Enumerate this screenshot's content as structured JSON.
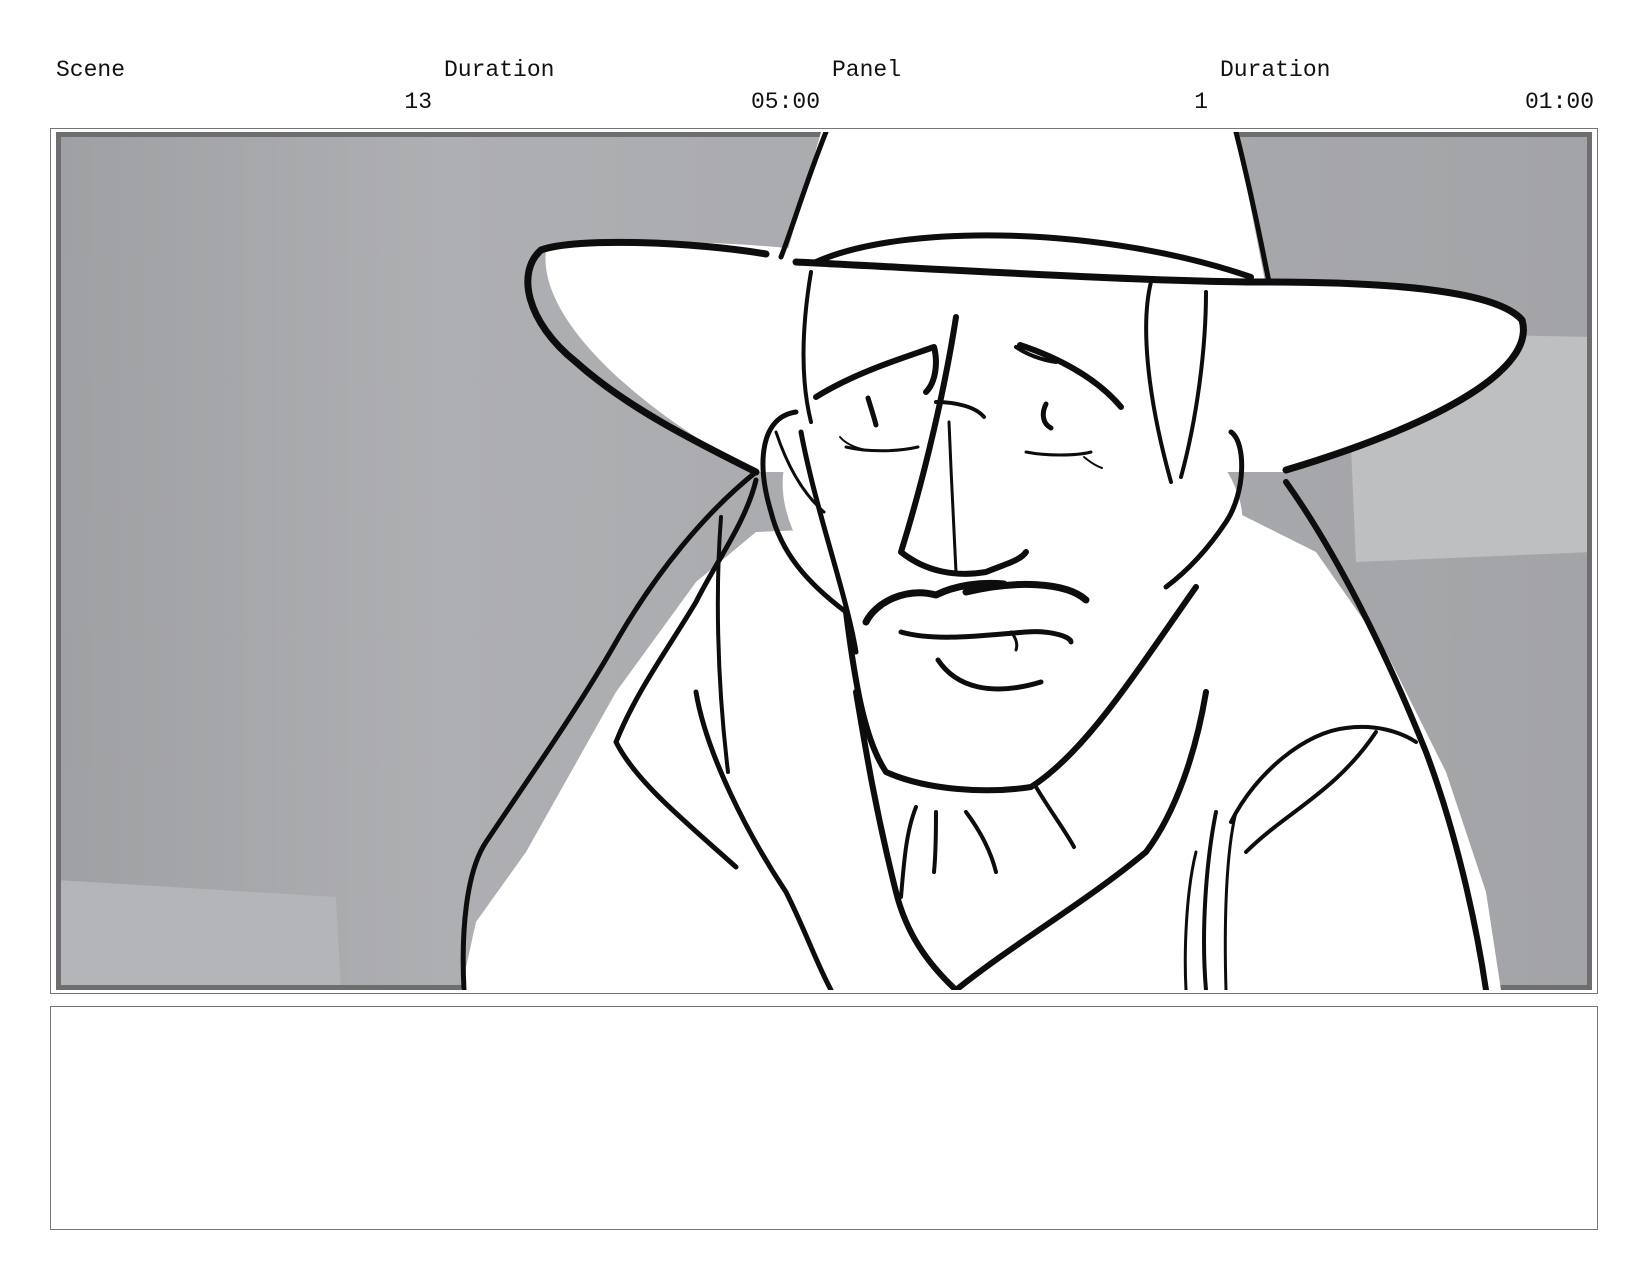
{
  "header": {
    "scene_label": "Scene",
    "scene_duration_label": "Duration",
    "panel_label": "Panel",
    "panel_duration_label": "Duration",
    "scene_value": "13",
    "scene_duration_value": "05:00",
    "panel_value": "1",
    "panel_duration_value": "01:00"
  },
  "colors": {
    "background_gray": "#a7a8ab",
    "line_art": "#0d0d0d",
    "frame_border": "#777777"
  },
  "notes": {
    "text": ""
  }
}
